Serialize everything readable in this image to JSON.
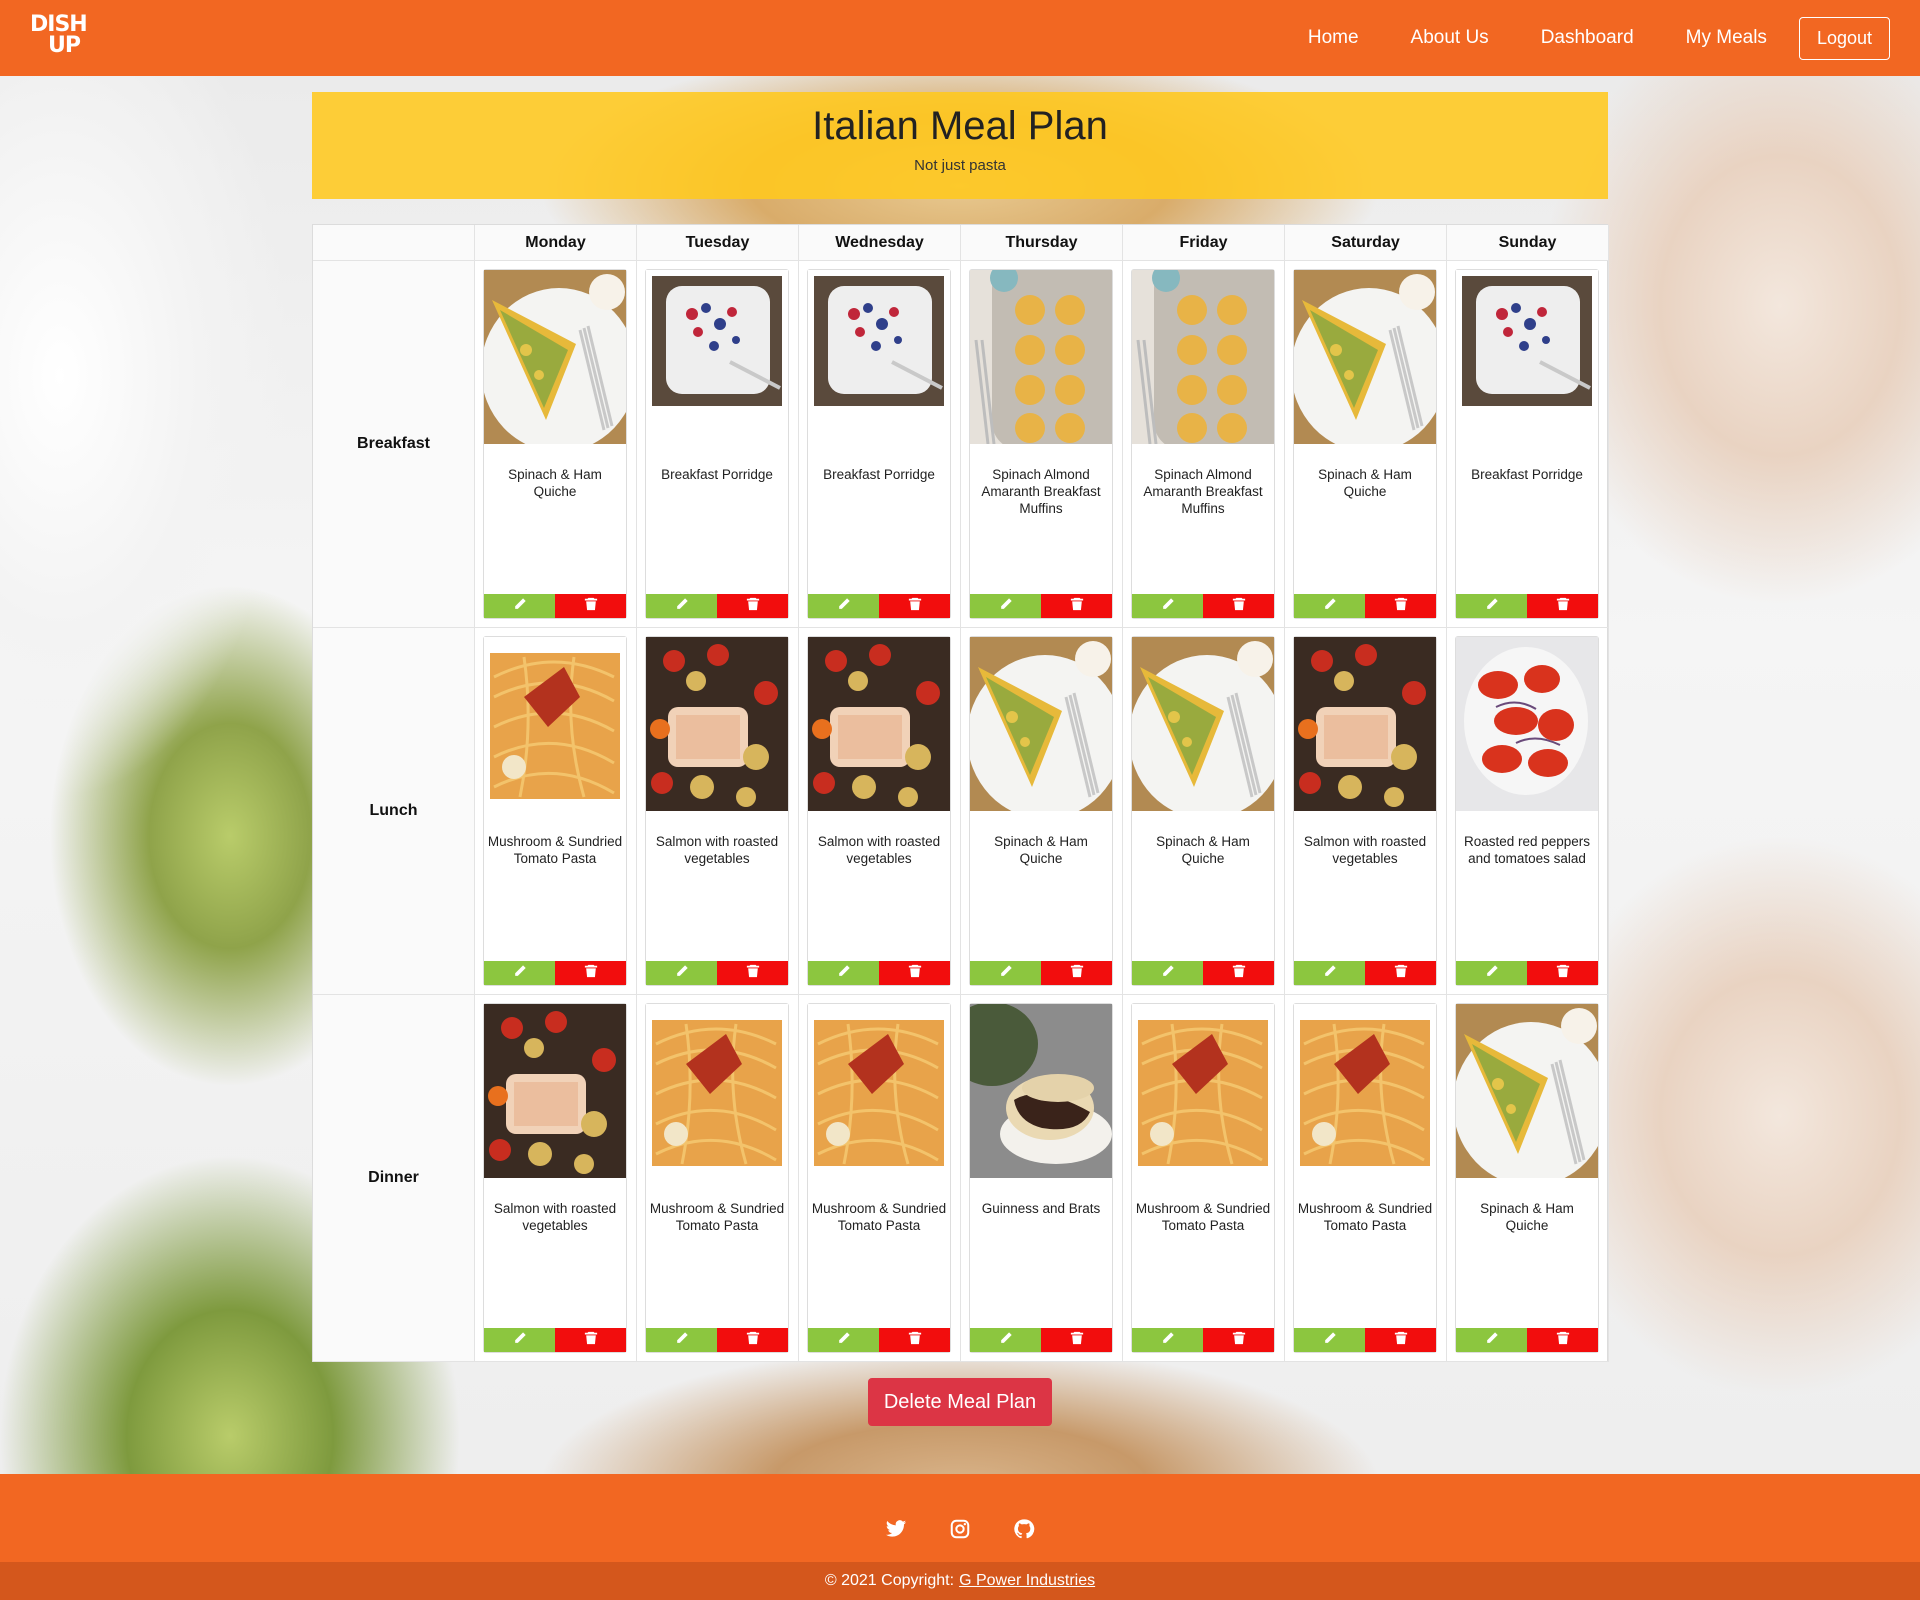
{
  "brand": {
    "logo_line1": "DISH",
    "logo_line2": "UP"
  },
  "nav": {
    "home": "Home",
    "about": "About Us",
    "dashboard": "Dashboard",
    "my_meals": "My Meals",
    "logout": "Logout"
  },
  "plan": {
    "title": "Italian Meal Plan",
    "subtitle": "Not just pasta"
  },
  "days": [
    "Monday",
    "Tuesday",
    "Wednesday",
    "Thursday",
    "Friday",
    "Saturday",
    "Sunday"
  ],
  "meal_types": [
    "Breakfast",
    "Lunch",
    "Dinner"
  ],
  "meals": [
    [
      {
        "name": "Spinach & Ham Quiche",
        "image": "quiche"
      },
      {
        "name": "Breakfast Porridge",
        "image": "porridge"
      },
      {
        "name": "Breakfast Porridge",
        "image": "porridge"
      },
      {
        "name": "Spinach Almond Amaranth Breakfast Muffins",
        "image": "muffins"
      },
      {
        "name": "Spinach Almond Amaranth Breakfast Muffins",
        "image": "muffins"
      },
      {
        "name": "Spinach & Ham Quiche",
        "image": "quiche"
      },
      {
        "name": "Breakfast Porridge",
        "image": "porridge"
      }
    ],
    [
      {
        "name": "Mushroom & Sundried Tomato Pasta",
        "image": "pasta"
      },
      {
        "name": "Salmon with roasted vegetables",
        "image": "salmon"
      },
      {
        "name": "Salmon with roasted vegetables",
        "image": "salmon"
      },
      {
        "name": "Spinach & Ham Quiche",
        "image": "quiche"
      },
      {
        "name": "Spinach & Ham Quiche",
        "image": "quiche"
      },
      {
        "name": "Salmon with roasted vegetables",
        "image": "salmon"
      },
      {
        "name": "Roasted red peppers and tomatoes salad",
        "image": "salad"
      }
    ],
    [
      {
        "name": "Salmon with roasted vegetables",
        "image": "salmon"
      },
      {
        "name": "Mushroom & Sundried Tomato Pasta",
        "image": "pasta"
      },
      {
        "name": "Mushroom & Sundried Tomato Pasta",
        "image": "pasta"
      },
      {
        "name": "Guinness and Brats",
        "image": "brats"
      },
      {
        "name": "Mushroom & Sundried Tomato Pasta",
        "image": "pasta"
      },
      {
        "name": "Mushroom & Sundried Tomato Pasta",
        "image": "pasta"
      },
      {
        "name": "Spinach & Ham Quiche",
        "image": "quiche"
      }
    ]
  ],
  "card_actions": {
    "edit_icon": "pencil-icon",
    "delete_icon": "trash-icon",
    "edit_color": "#8cc63f",
    "delete_color": "#f20d0d"
  },
  "delete_plan_label": "Delete Meal Plan",
  "footer": {
    "social": [
      "twitter-icon",
      "instagram-icon",
      "github-icon"
    ],
    "copyright_text": "© 2021 Copyright:",
    "company": "G Power Industries"
  },
  "colors": {
    "brand_orange": "#f26722",
    "banner_yellow": "#ffc81e",
    "danger": "#dc3545"
  }
}
